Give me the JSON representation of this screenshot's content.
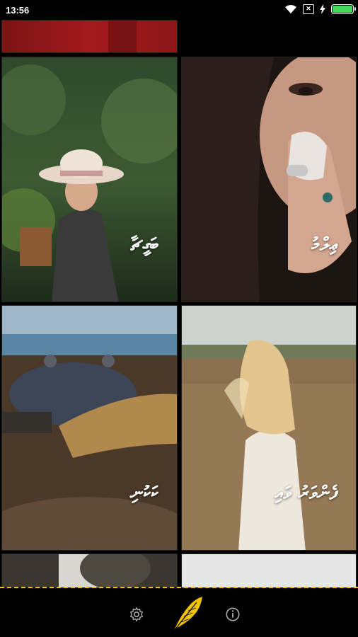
{
  "status_bar": {
    "time": "13:56",
    "sim_icon": "sim-x-icon",
    "battery_level": 1.0,
    "battery_color": "#46d85c"
  },
  "colors": {
    "accent": "#f0c300",
    "background": "#000000"
  },
  "tiles": [
    {
      "label": "",
      "image": "red-background-photo"
    },
    {
      "label": "ބަގީޗާ",
      "image": "woman-with-hat-in-garden-photo"
    },
    {
      "label": "ޢިލްމު",
      "image": "woman-closeup-face-photo"
    },
    {
      "label": "ކަކުނި",
      "image": "crab-on-beach-photo"
    },
    {
      "label": "ފެންވަރު ވައި",
      "image": "girl-in-wheat-field-photo"
    }
  ],
  "nav": {
    "settings_icon": "gear-icon",
    "center_icon": "feather-icon",
    "info_icon": "info-icon"
  }
}
